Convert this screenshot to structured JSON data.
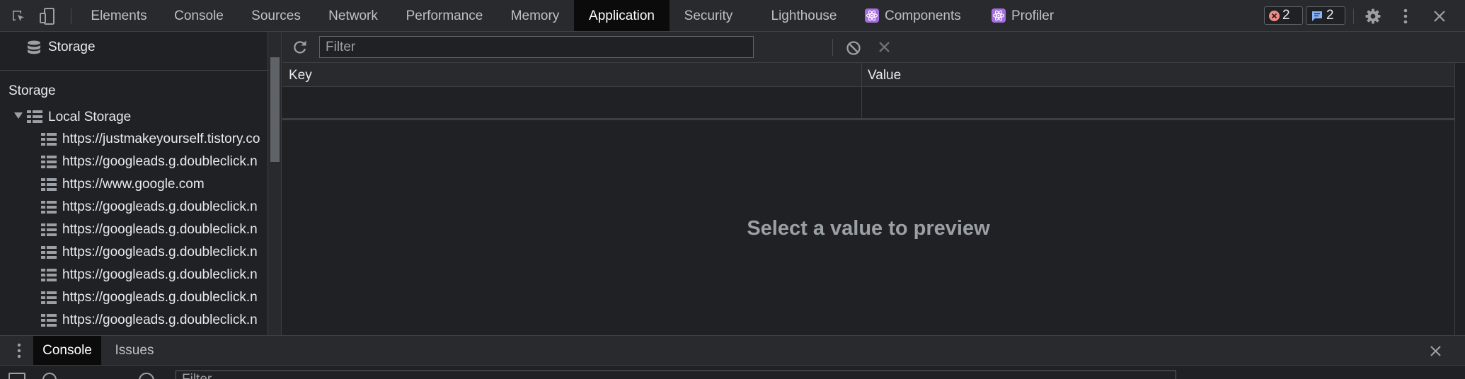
{
  "topbar": {
    "tabs": [
      {
        "label": "Elements"
      },
      {
        "label": "Console"
      },
      {
        "label": "Sources"
      },
      {
        "label": "Network"
      },
      {
        "label": "Performance"
      },
      {
        "label": "Memory"
      },
      {
        "label": "Application",
        "active": true
      },
      {
        "label": "Security"
      },
      {
        "label": "Lighthouse"
      },
      {
        "label": "Components",
        "icon": "react-icon"
      },
      {
        "label": "Profiler",
        "icon": "react-icon"
      }
    ],
    "errors_count": "2",
    "messages_count": "2",
    "colors": {
      "error": "#f28b82",
      "message": "#8ab4f8",
      "react": "#a56ee0"
    }
  },
  "sidebar": {
    "header": "Storage",
    "section_title": "Storage",
    "local_storage_label": "Local Storage",
    "origins": [
      "https://justmakeyourself.tistory.co",
      "https://googleads.g.doubleclick.n",
      "https://www.google.com",
      "https://googleads.g.doubleclick.n",
      "https://googleads.g.doubleclick.n",
      "https://googleads.g.doubleclick.n",
      "https://googleads.g.doubleclick.n",
      "https://googleads.g.doubleclick.n",
      "https://googleads.g.doubleclick.n"
    ]
  },
  "main": {
    "filter_placeholder": "Filter",
    "columns": {
      "key": "Key",
      "value": "Value"
    },
    "preview_message": "Select a value to preview"
  },
  "drawer": {
    "tabs": [
      {
        "label": "Console",
        "active": true
      },
      {
        "label": "Issues"
      }
    ],
    "filter_placeholder": "Filter"
  }
}
